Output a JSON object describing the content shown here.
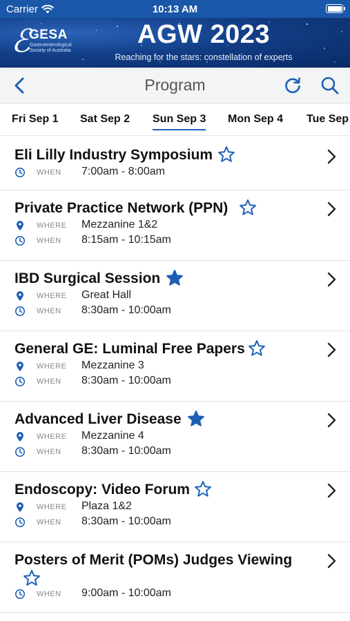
{
  "status_bar": {
    "carrier": "Carrier",
    "time": "10:13 AM"
  },
  "banner": {
    "logo_name": "GESA",
    "logo_subtitle": "Gastroenterological Society of Australia",
    "title": "AGW 2023",
    "tagline": "Reaching for the stars: constellation of experts"
  },
  "navbar": {
    "title": "Program"
  },
  "tabs": [
    {
      "label": "Fri Sep 1",
      "active": false
    },
    {
      "label": "Sat Sep 2",
      "active": false
    },
    {
      "label": "Sun Sep 3",
      "active": true
    },
    {
      "label": "Mon Sep 4",
      "active": false
    },
    {
      "label": "Tue Sep",
      "active": false
    }
  ],
  "labels": {
    "where": "WHERE",
    "when": "WHEN"
  },
  "sessions": [
    {
      "title": "Eli Lilly Industry Symposium",
      "starred": false,
      "where": "",
      "when": "7:00am - 8:00am"
    },
    {
      "title": "Private Practice Network (PPN)",
      "starred": false,
      "where": "Mezzanine 1&2",
      "when": "8:15am - 10:15am"
    },
    {
      "title": "IBD Surgical Session",
      "starred": true,
      "where": "Great Hall",
      "when": "8:30am - 10:00am"
    },
    {
      "title": "General GE: Luminal Free Papers",
      "starred": false,
      "where": "Mezzanine 3",
      "when": "8:30am - 10:00am"
    },
    {
      "title": "Advanced Liver Disease",
      "starred": true,
      "where": "Mezzanine 4",
      "when": "8:30am - 10:00am"
    },
    {
      "title": "Endoscopy: Video Forum",
      "starred": false,
      "where": "Plaza 1&2",
      "when": "8:30am - 10:00am"
    },
    {
      "title": "Posters of Merit (POMs) Judges Viewing",
      "starred": false,
      "where": "",
      "when": "9:00am - 10:00am"
    }
  ],
  "colors": {
    "accent": "#1c5fb5",
    "status_bar": "#1a57a8",
    "banner": "#123e86"
  }
}
